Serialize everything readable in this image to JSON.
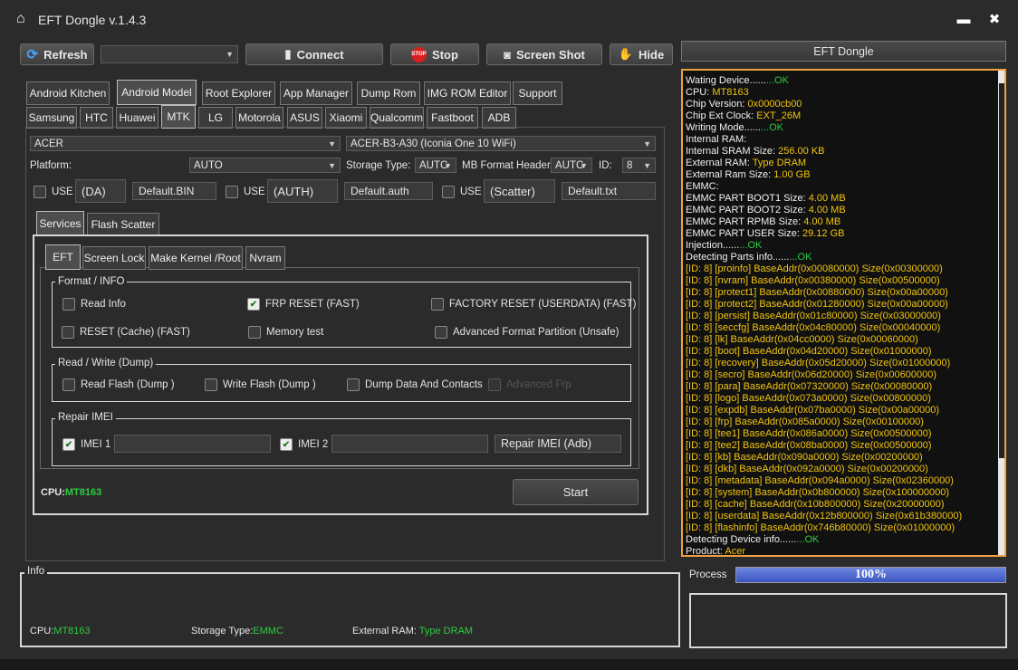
{
  "app": {
    "title": "EFT Dongle  v.1.4.3",
    "minimize": "▬",
    "close": "✖"
  },
  "toolbar": {
    "refresh": "Refresh",
    "connect": "Connect",
    "stop": "Stop",
    "screenshot": "Screen Shot",
    "hide": "Hide",
    "port_value": "",
    "stop_icon_text": "STOP"
  },
  "main_tabs": [
    "Android Kitchen",
    "Android Model",
    "Root Explorer",
    "App Manager",
    "Dump Rom",
    "IMG ROM Editor",
    "Support"
  ],
  "brand_tabs": [
    "Samsung",
    "HTC",
    "Huawei",
    "MTK",
    "LG",
    "Motorola",
    "ASUS",
    "Xiaomi",
    "Qualcomm",
    "Fastboot",
    "ADB"
  ],
  "selectors": {
    "brand": "ACER",
    "model": "ACER-B3-A30 (Iconia One 10 WiFi)",
    "platform_label": "Platform:",
    "platform_value": "AUTO",
    "storage_label": "Storage Type:",
    "storage_value": "AUTC",
    "mb_label": "MB Format Header",
    "mb_value": "AUTC",
    "id_label": "ID:",
    "id_value": "8"
  },
  "files": {
    "use": "USE",
    "da_btn": "(DA)",
    "da_file": "Default.BIN",
    "auth_btn": "(AUTH)",
    "auth_file": "Default.auth",
    "scatter_btn": "(Scatter)",
    "scatter_file": "Default.txt"
  },
  "sub_tabs": [
    "Services",
    "Flash Scatter"
  ],
  "service_tabs": [
    "EFT",
    "Screen Lock",
    "Make Kernel  /Root",
    "Nvram"
  ],
  "format_group": {
    "legend": "Format / INFO",
    "read_info": "Read Info",
    "frp_reset": "FRP RESET (FAST)",
    "factory_reset": "FACTORY RESET (USERDATA) (FAST)",
    "reset_cache": "RESET (Cache) (FAST)",
    "memory_test": "Memory test",
    "adv_format": "Advanced Format Partition (Unsafe)"
  },
  "rw_group": {
    "legend": "Read / Write (Dump)",
    "read_flash": "Read Flash (Dump )",
    "write_flash": "Write Flash (Dump )",
    "dump_data": "Dump Data And Contacts",
    "adv_frp": "Advanced Frp"
  },
  "imei_group": {
    "legend": "Repair IMEI",
    "imei1": "IMEI 1",
    "imei2": "IMEI 2",
    "repair": "Repair IMEI (Adb)"
  },
  "cpu_status": {
    "label": "CPU:",
    "value": "MT8163"
  },
  "start": "Start",
  "info": {
    "legend": "Info",
    "cpu_label": "CPU:",
    "cpu_value": "MT8163",
    "storage_label": "Storage Type:",
    "storage_value": "EMMC",
    "ram_label": "External RAM:",
    "ram_value": "Type DRAM"
  },
  "right_panel": {
    "title": "EFT Dongle",
    "process_label": "Process",
    "progress_text": "100%",
    "progress": 1.0
  },
  "log": [
    [
      [
        "w",
        "Wating Device......"
      ],
      [
        "g",
        "...OK"
      ]
    ],
    [
      [
        "w",
        "CPU: "
      ],
      [
        "y",
        "MT8163"
      ]
    ],
    [
      [
        "w",
        "Chip Version: "
      ],
      [
        "y",
        "0x0000cb00"
      ]
    ],
    [
      [
        "w",
        "Chip Ext Clock: "
      ],
      [
        "y",
        "EXT_26M"
      ]
    ],
    [
      [
        "w",
        "Writing Mode......"
      ],
      [
        "g",
        "...OK"
      ]
    ],
    [
      [
        "w",
        "Internal RAM:"
      ]
    ],
    [
      [
        "w",
        "Internal SRAM Size: "
      ],
      [
        "y",
        "256.00 KB"
      ]
    ],
    [
      [
        "w",
        "External RAM: "
      ],
      [
        "y",
        "Type DRAM"
      ]
    ],
    [
      [
        "w",
        "External Ram Size: "
      ],
      [
        "y",
        "1.00 GB"
      ]
    ],
    [
      [
        "w",
        "EMMC:"
      ]
    ],
    [
      [
        "w",
        "EMMC PART BOOT1 Size: "
      ],
      [
        "y",
        "4.00 MB"
      ]
    ],
    [
      [
        "w",
        "EMMC PART BOOT2 Size: "
      ],
      [
        "y",
        "4.00 MB"
      ]
    ],
    [
      [
        "w",
        "EMMC PART RPMB Size: "
      ],
      [
        "y",
        "4.00 MB"
      ]
    ],
    [
      [
        "w",
        "EMMC PART USER Size: "
      ],
      [
        "y",
        "29.12 GB"
      ]
    ],
    [
      [
        "w",
        "Injection......"
      ],
      [
        "g",
        "...OK"
      ]
    ],
    [
      [
        "w",
        "Detecting Parts info......"
      ],
      [
        "g",
        "...OK"
      ]
    ],
    [
      [
        "y",
        "[ID: 8] [proinfo] BaseAddr(0x00080000) Size(0x00300000)"
      ]
    ],
    [
      [
        "y",
        "[ID: 8] [nvram] BaseAddr(0x00380000) Size(0x00500000)"
      ]
    ],
    [
      [
        "y",
        "[ID: 8] [protect1] BaseAddr(0x00880000) Size(0x00a00000)"
      ]
    ],
    [
      [
        "y",
        "[ID: 8] [protect2] BaseAddr(0x01280000) Size(0x00a00000)"
      ]
    ],
    [
      [
        "y",
        "[ID: 8] [persist] BaseAddr(0x01c80000) Size(0x03000000)"
      ]
    ],
    [
      [
        "y",
        "[ID: 8] [seccfg] BaseAddr(0x04c80000) Size(0x00040000)"
      ]
    ],
    [
      [
        "y",
        "[ID: 8] [lk] BaseAddr(0x04cc0000) Size(0x00060000)"
      ]
    ],
    [
      [
        "y",
        "[ID: 8] [boot] BaseAddr(0x04d20000) Size(0x01000000)"
      ]
    ],
    [
      [
        "y",
        "[ID: 8] [recovery] BaseAddr(0x05d20000) Size(0x01000000)"
      ]
    ],
    [
      [
        "y",
        "[ID: 8] [secro] BaseAddr(0x06d20000) Size(0x00600000)"
      ]
    ],
    [
      [
        "y",
        "[ID: 8] [para] BaseAddr(0x07320000) Size(0x00080000)"
      ]
    ],
    [
      [
        "y",
        "[ID: 8] [logo] BaseAddr(0x073a0000) Size(0x00800000)"
      ]
    ],
    [
      [
        "y",
        "[ID: 8] [expdb] BaseAddr(0x07ba0000) Size(0x00a00000)"
      ]
    ],
    [
      [
        "y",
        "[ID: 8] [frp] BaseAddr(0x085a0000) Size(0x00100000)"
      ]
    ],
    [
      [
        "y",
        "[ID: 8] [tee1] BaseAddr(0x086a0000) Size(0x00500000)"
      ]
    ],
    [
      [
        "y",
        "[ID: 8] [tee2] BaseAddr(0x08ba0000) Size(0x00500000)"
      ]
    ],
    [
      [
        "y",
        "[ID: 8] [kb] BaseAddr(0x090a0000) Size(0x00200000)"
      ]
    ],
    [
      [
        "y",
        "[ID: 8] [dkb] BaseAddr(0x092a0000) Size(0x00200000)"
      ]
    ],
    [
      [
        "y",
        "[ID: 8] [metadata] BaseAddr(0x094a0000) Size(0x02360000)"
      ]
    ],
    [
      [
        "y",
        "[ID: 8] [system] BaseAddr(0x0b800000) Size(0x100000000)"
      ]
    ],
    [
      [
        "y",
        "[ID: 8] [cache] BaseAddr(0x10b800000) Size(0x20000000)"
      ]
    ],
    [
      [
        "y",
        "[ID: 8] [userdata] BaseAddr(0x12b800000) Size(0x61b380000)"
      ]
    ],
    [
      [
        "y",
        "[ID: 8] [flashinfo] BaseAddr(0x746b80000) Size(0x01000000)"
      ]
    ],
    [
      [
        "w",
        "Detecting Device info......"
      ],
      [
        "g",
        "...OK"
      ]
    ],
    [
      [
        "w",
        "Product: "
      ],
      [
        "y",
        "Acer"
      ]
    ]
  ],
  "colors": {
    "accent_green": "#2ecc40",
    "log_yellow": "#f1c40f",
    "log_border": "#f0a040",
    "progress": "#4a63c8"
  }
}
